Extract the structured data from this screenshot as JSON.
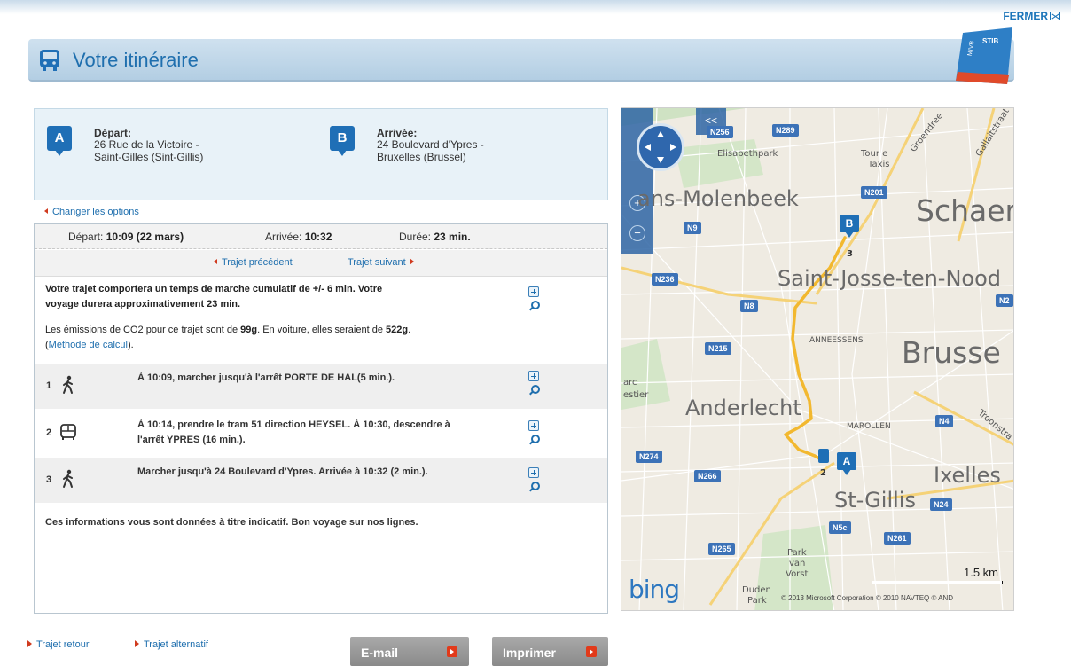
{
  "window": {
    "close_label": "FERMER"
  },
  "header": {
    "title": "Votre itinéraire",
    "bus_icon": "bus-icon",
    "logo_text": "MIVB STIB"
  },
  "departure": {
    "marker": "A",
    "label": "Départ:",
    "line1": "26 Rue de la Victoire -",
    "line2": "Saint-Gilles (Sint-Gillis)"
  },
  "arrival": {
    "marker": "B",
    "label": "Arrivée:",
    "line1": "24 Boulevard d'Ypres -",
    "line2": "Bruxelles (Brussel)"
  },
  "change_options": "Changer les options",
  "summary": {
    "depart_label": "Départ:",
    "depart_value": "10:09 (22 mars)",
    "arrive_label": "Arrivée:",
    "arrive_value": "10:32",
    "duration_label": "Durée:",
    "duration_value": "23 min."
  },
  "nav": {
    "previous": "Trajet précédent",
    "next": "Trajet suivant"
  },
  "info": {
    "walk_line1": "Votre trajet comportera un temps de marche cumulatif de +/- 6 min. Votre",
    "walk_line2": "voyage durera approximativement 23 min.",
    "co2_prefix": "Les émissions de CO2 pour ce trajet sont de ",
    "co2_value": "99g",
    "co2_middle": ". En voiture, elles seraient de ",
    "co2_car": "522g",
    "co2_suffix": ".",
    "method_open": "(",
    "method_link": "Méthode de calcul",
    "method_close": ")."
  },
  "steps": [
    {
      "num": "1",
      "icon": "walk-icon",
      "line1": "À 10:09, marcher jusqu'à l'arrêt PORTE DE HAL(5 min.).",
      "line2": ""
    },
    {
      "num": "2",
      "icon": "tram-icon",
      "line1": "À 10:14, prendre le tram 51 direction HEYSEL. À 10:30, descendre à",
      "line2": "l'arrêt YPRES (16 min.)."
    },
    {
      "num": "3",
      "icon": "walk-icon",
      "line1": "Marcher jusqu'à 24 Boulevard d'Ypres. Arrivée à 10:32 (2 min.).",
      "line2": ""
    }
  ],
  "footer_note": "Ces informations vous sont données à titre indicatif. Bon voyage sur nos lignes.",
  "bottom": {
    "return_trip": "Trajet retour",
    "alt_trip": "Trajet alternatif",
    "email": "E-mail",
    "print": "Imprimer"
  },
  "map": {
    "collapse": "<<",
    "labels": {
      "molenbeek": "ans-Molenbeek",
      "schaer": "Schaer",
      "sjtn": "Saint-Josse-ten-Nood",
      "brussel": "Brusse",
      "anderlecht": "Anderlecht",
      "ixelles": "Ixelles",
      "stgillis": "St-Gillis",
      "anneessens": "ANNEESSENS",
      "marollen": "MAROLLEN",
      "elisabethpark": "Elisabethpark",
      "tour_taxis_1": "Tour e",
      "tour_taxis_2": "Taxis",
      "park_van_vorst_1": "Park",
      "park_van_vorst_2": "van",
      "park_van_vorst_3": "Vorst",
      "duden_1": "Duden",
      "duden_2": "Park",
      "groendreef": "Groendree",
      "gallaitstraat": "Gallaitstraat",
      "troonstraat": "Troonstra",
      "estier": "estier",
      "parc": "arc"
    },
    "roads": [
      "N289",
      "N201",
      "N9",
      "N236",
      "N8",
      "N215",
      "N2",
      "N4",
      "N274",
      "N266",
      "N24",
      "N5c",
      "N261",
      "N265",
      "N256"
    ],
    "markers": {
      "start": "A",
      "end": "B",
      "step2": "2",
      "step3": "3"
    },
    "scale": "1.5 km",
    "copyright": "© 2013 Microsoft Corporation   © 2010 NAVTEQ   © AND",
    "brand": "bing"
  }
}
